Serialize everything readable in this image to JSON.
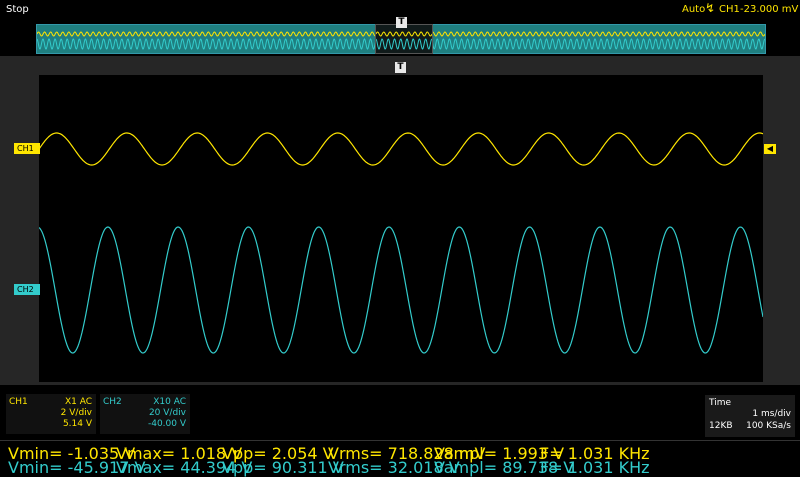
{
  "top": {
    "run_state": "Stop",
    "trigger_mode": "Auto",
    "trigger_icon": "trigger-edge-icon",
    "trigger_source": "CH1",
    "trigger_level": "-23.000 mV"
  },
  "markers": {
    "trigger_position": "T",
    "ch1": "CH1",
    "ch2": "CH2"
  },
  "colors": {
    "ch1": "#ffe600",
    "ch2": "#33cccc",
    "overview_bg": "#1f7f80"
  },
  "channels": [
    {
      "name": "CH1",
      "probe_coupling": "X1  AC",
      "volts_per_div": "2 V/div",
      "offset": "5.14 V"
    },
    {
      "name": "CH2",
      "probe_coupling": "X10  AC",
      "volts_per_div": "20 V/div",
      "offset": "-40.00 V"
    }
  ],
  "timebase": {
    "label": "Time",
    "time_per_div": "1 ms/div",
    "memory_depth": "12KB",
    "sample_rate": "100 KSa/s"
  },
  "measurements": {
    "ch1": {
      "vmin": "Vmin= -1.035 V",
      "vmax": "Vmax= 1.018 V",
      "vpp": "Vpp= 2.054 V",
      "vrms": "Vrms= 718.828 mV",
      "vampl": "Vampl= 1.993 V",
      "freq": "F= 1.031 KHz"
    },
    "ch2": {
      "vmin": "Vmin= -45.917 V",
      "vmax": "Vmax= 44.394 V",
      "vpp": "Vpp= 90.311 V",
      "vrms": "Vrms= 32.018 V",
      "vampl": "Vampl= 89.738 V",
      "freq": "F= 1.031 KHz"
    }
  }
}
